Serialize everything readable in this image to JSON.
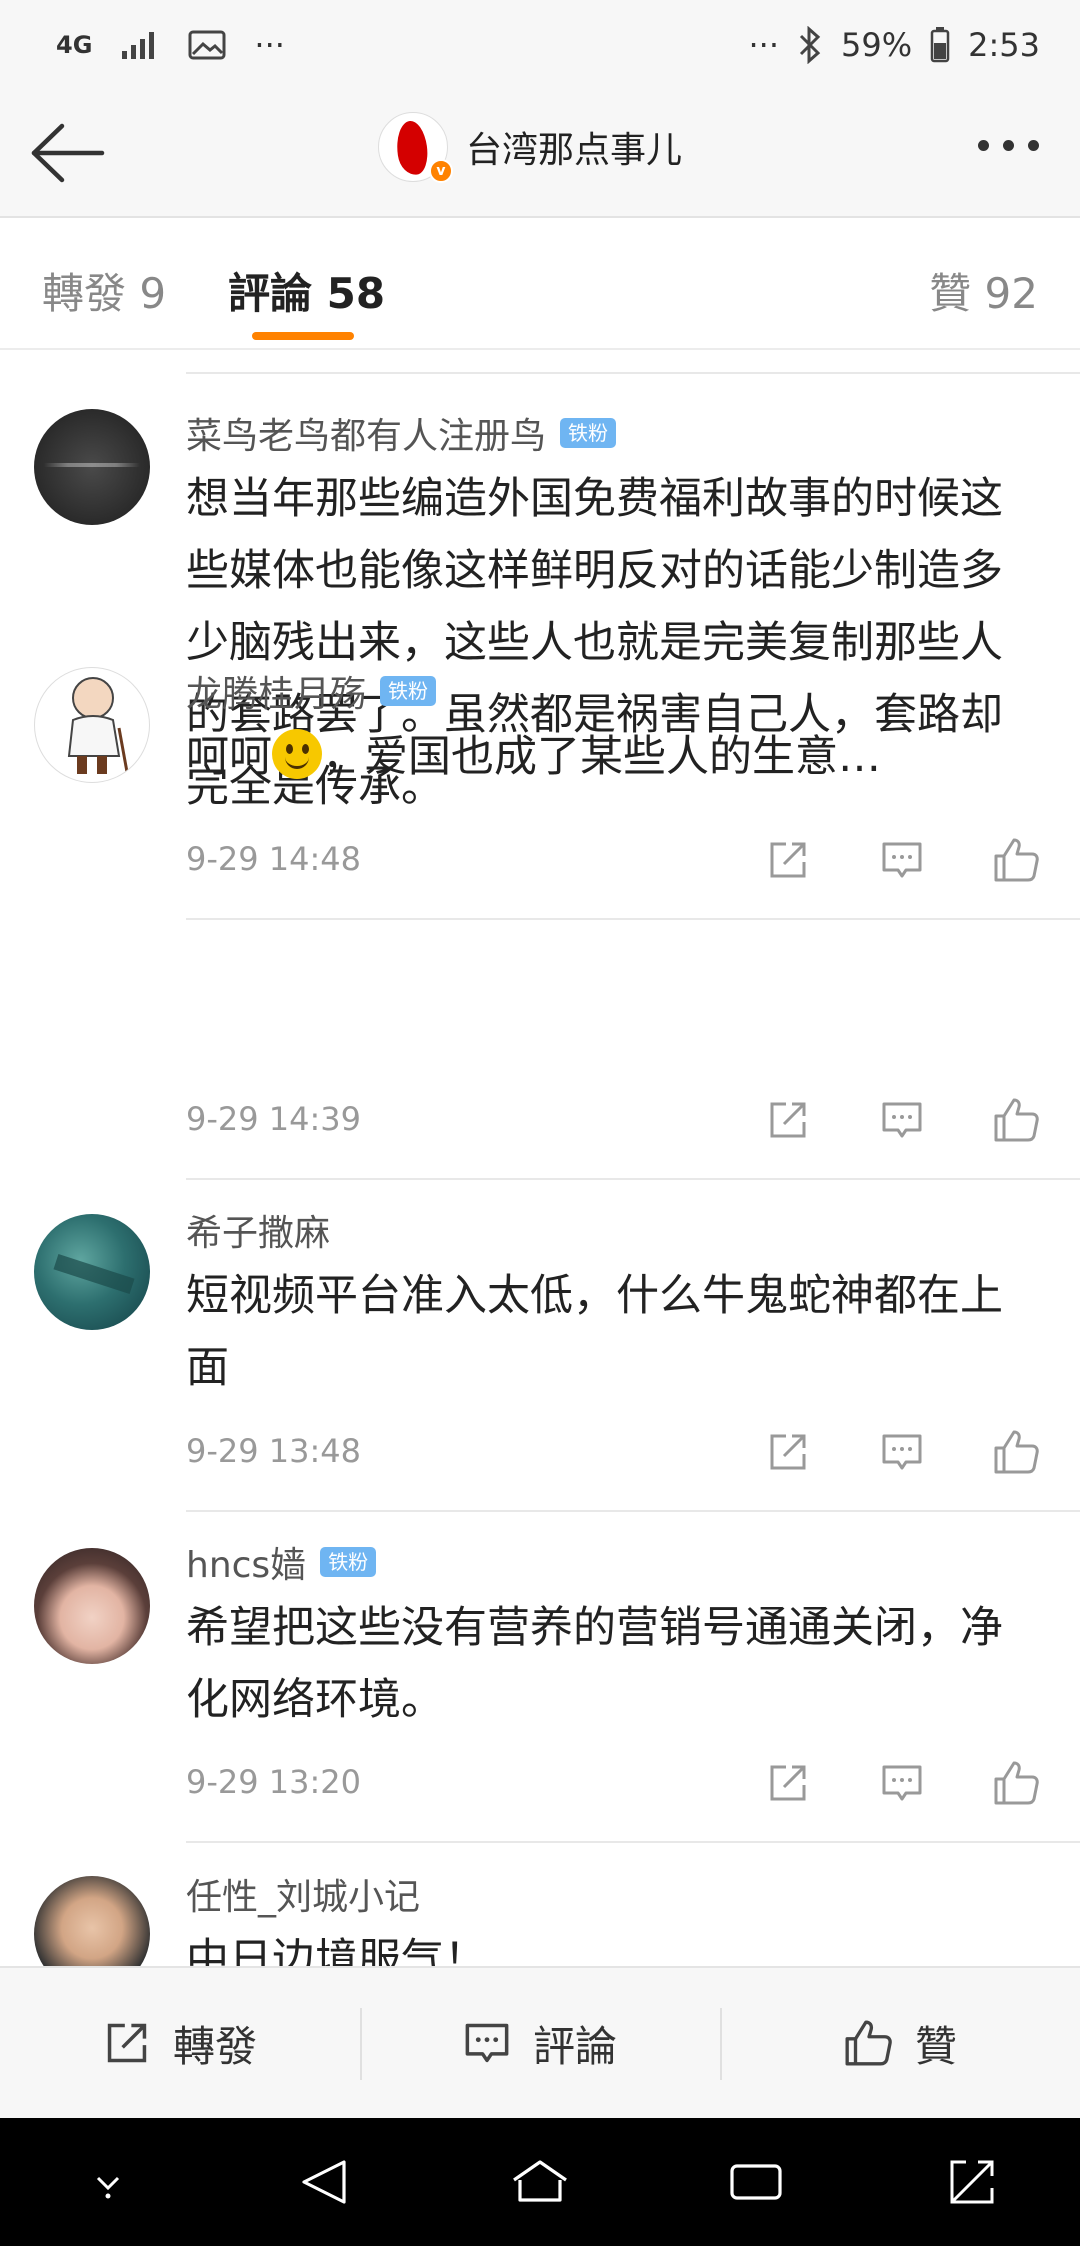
{
  "status_bar": {
    "network": "4G",
    "more_left": "···",
    "more_right": "···",
    "battery": "59%",
    "time": "2:53"
  },
  "header": {
    "title": "台湾那点事儿",
    "avatar_badge": "v"
  },
  "tabs": {
    "repost": "轉發 9",
    "comment": "評論 58",
    "like": "贊 92"
  },
  "comments": [
    {
      "name": "菜鸟老鸟都有人注册鸟",
      "badge": "铁粉",
      "text": "想当年那些编造外国免费福利故事的时候这些媒体也能像这样鲜明反对的话能少制造多少脑残出来，这些人也就是完美复制那些人的套路罢了。虽然都是祸害自己人，套路却完全是传承。",
      "time": "9-29 14:48"
    },
    {
      "name": "龙腾桂月殇",
      "badge": "铁粉",
      "text_before": "呵呵",
      "text_after": "，爱国也成了某些人的生意…",
      "time": "9-29 14:39"
    },
    {
      "name": "希子撒麻",
      "badge": "",
      "text": "短视频平台准入太低，什么牛鬼蛇神都在上面",
      "time": "9-29 13:48"
    },
    {
      "name": "hncs嫱",
      "badge": "铁粉",
      "text": "希望把这些没有营养的营销号通通关闭，净化网络环境。",
      "time": "9-29 13:20"
    },
    {
      "name": "任性_刘城小记",
      "badge": "",
      "text": "中日边境服气！",
      "time": ""
    }
  ],
  "bottom_bar": {
    "repost": "轉發",
    "comment": "評論",
    "like": "贊"
  },
  "colors": {
    "accent": "#ff8200",
    "badge": "#6fb5f2"
  },
  "icons": [
    "back-arrow-icon",
    "more-dots-icon",
    "share-icon",
    "comment-icon",
    "like-icon",
    "nav-down-icon",
    "nav-back-icon",
    "nav-home-icon",
    "nav-recents-icon",
    "nav-expand-icon"
  ]
}
